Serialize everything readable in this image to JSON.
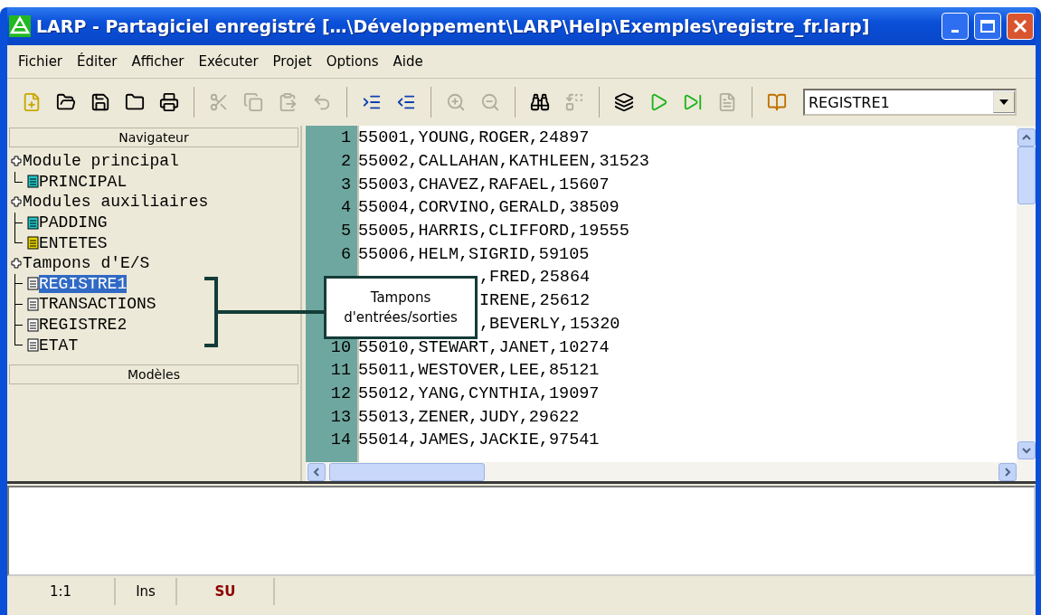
{
  "window": {
    "title": "LARP - Partagiciel enregistré […\\Développement\\LARP\\Help\\Exemples\\registre_fr.larp]"
  },
  "menu": [
    "Fichier",
    "Éditer",
    "Afficher",
    "Exécuter",
    "Projet",
    "Options",
    "Aide"
  ],
  "toolbar": [
    [
      {
        "disabled": false
      },
      {
        "disabled": false
      },
      {
        "disabled": false
      },
      {
        "disabled": false
      },
      {
        "disabled": false
      }
    ],
    [
      {
        "disabled": true
      },
      {
        "disabled": true
      },
      {
        "disabled": true
      },
      {
        "disabled": true
      }
    ],
    [
      {
        "disabled": false
      },
      {
        "disabled": false
      }
    ],
    [
      {
        "disabled": true
      },
      {
        "disabled": true
      }
    ],
    [
      {
        "disabled": false
      },
      {
        "disabled": true
      }
    ],
    [
      {
        "disabled": false
      },
      {
        "disabled": false
      },
      {
        "disabled": false
      },
      {
        "disabled": true
      }
    ],
    [
      {
        "disabled": false
      }
    ]
  ],
  "buffer_select": {
    "value": "REGISTRE1"
  },
  "navigator": {
    "title": "Navigateur",
    "tree": [
      {
        "label": "Module principal",
        "children": [
          {
            "label": "PRINCIPAL",
            "kind": "module",
            "selected": false
          }
        ]
      },
      {
        "label": "Modules auxiliaires",
        "children": [
          {
            "label": "PADDING",
            "kind": "module",
            "selected": false
          },
          {
            "label": "ENTETES",
            "kind": "structure",
            "selected": false
          }
        ]
      },
      {
        "label": "Tampons d'E/S",
        "children": [
          {
            "label": "REGISTRE1",
            "kind": "buffer",
            "selected": true
          },
          {
            "label": "TRANSACTIONS",
            "kind": "buffer",
            "selected": false
          },
          {
            "label": "REGISTRE2",
            "kind": "buffer",
            "selected": false
          },
          {
            "label": "ETAT",
            "kind": "buffer",
            "selected": false
          }
        ]
      }
    ]
  },
  "templates": {
    "title": "Modèles"
  },
  "editor": {
    "lines": [
      {
        "number": "1",
        "text": "55001,YOUNG,ROGER,24897",
        "kind": "full"
      },
      {
        "number": "2",
        "text": "55002,CALLAHAN,KATHLEEN,31523",
        "kind": "full"
      },
      {
        "number": "3",
        "text": "55003,CHAVEZ,RAFAEL,15607",
        "kind": "full"
      },
      {
        "number": "4",
        "text": "55004,CORVINO,GERALD,38509",
        "kind": "full"
      },
      {
        "number": "5",
        "text": "55005,HARRIS,CLIFFORD,19555",
        "kind": "full"
      },
      {
        "number": "6",
        "text": "55006,HELM,SIGRID,59105",
        "kind": "full"
      },
      {
        "text": ",FRED,25864",
        "kind": "partial"
      },
      {
        "text": "IRENE,25612",
        "kind": "partial"
      },
      {
        "text": ",BEVERLY,15320",
        "kind": "partial"
      },
      {
        "number": "10",
        "text": "55010,STEWART,JANET,10274",
        "kind": "full"
      },
      {
        "number": "11",
        "text": "55011,WESTOVER,LEE,85121",
        "kind": "full"
      },
      {
        "number": "12",
        "text": "55012,YANG,CYNTHIA,19097",
        "kind": "full"
      },
      {
        "number": "13",
        "text": "55013,ZENER,JUDY,29622",
        "kind": "full"
      },
      {
        "number": "14",
        "text": "55014,JAMES,JACKIE,97541",
        "kind": "full"
      }
    ]
  },
  "callout": {
    "lines": [
      "Tampons",
      "d'entrées/sorties"
    ]
  },
  "status_bar": [
    {
      "text": "1:1",
      "kind": "plain"
    },
    {
      "text": "Ins",
      "kind": "plain"
    },
    {
      "text": "SU",
      "kind": "alert"
    }
  ]
}
